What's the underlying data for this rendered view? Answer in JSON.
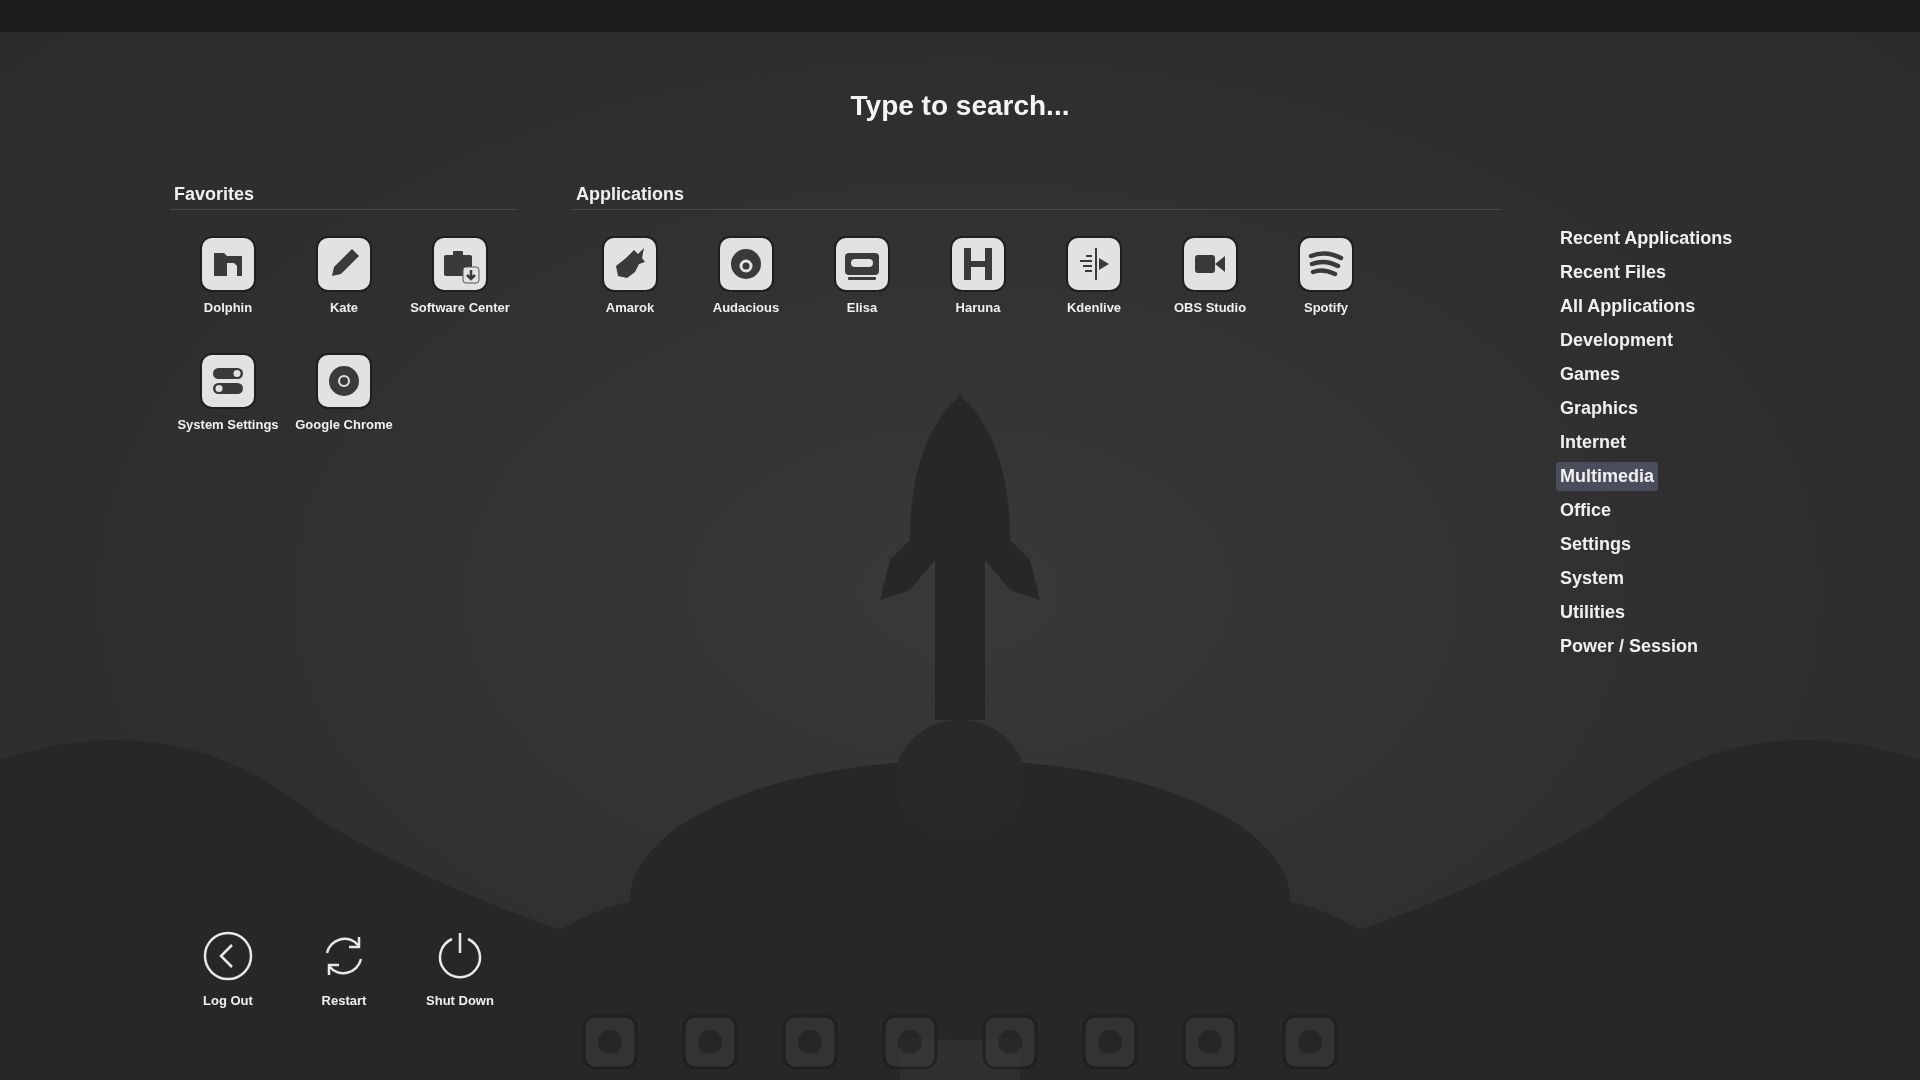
{
  "search": {
    "placeholder": "Type to search..."
  },
  "favorites": {
    "title": "Favorites",
    "apps": [
      {
        "name": "Dolphin"
      },
      {
        "name": "Kate"
      },
      {
        "name": "Software Center"
      },
      {
        "name": "System Settings"
      },
      {
        "name": "Google Chrome"
      }
    ]
  },
  "applications": {
    "title": "Applications",
    "apps": [
      {
        "name": "Amarok"
      },
      {
        "name": "Audacious"
      },
      {
        "name": "Elisa"
      },
      {
        "name": "Haruna"
      },
      {
        "name": "Kdenlive"
      },
      {
        "name": "OBS Studio"
      },
      {
        "name": "Spotify"
      }
    ]
  },
  "categories": [
    {
      "label": "Recent Applications",
      "selected": false
    },
    {
      "label": "Recent Files",
      "selected": false
    },
    {
      "label": "All Applications",
      "selected": false
    },
    {
      "label": "Development",
      "selected": false
    },
    {
      "label": "Games",
      "selected": false
    },
    {
      "label": "Graphics",
      "selected": false
    },
    {
      "label": "Internet",
      "selected": false
    },
    {
      "label": "Multimedia",
      "selected": true
    },
    {
      "label": "Office",
      "selected": false
    },
    {
      "label": "Settings",
      "selected": false
    },
    {
      "label": "System",
      "selected": false
    },
    {
      "label": "Utilities",
      "selected": false
    },
    {
      "label": "Power / Session",
      "selected": false
    }
  ],
  "power": [
    {
      "label": "Log Out"
    },
    {
      "label": "Restart"
    },
    {
      "label": "Shut Down"
    }
  ]
}
